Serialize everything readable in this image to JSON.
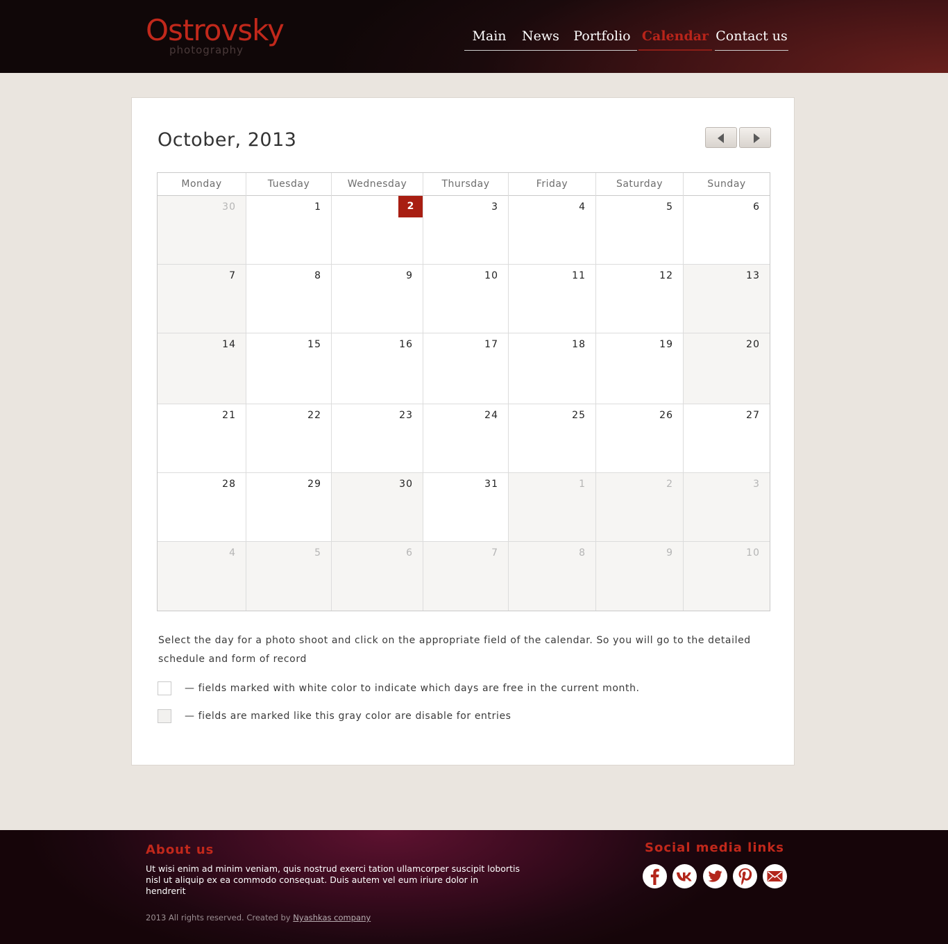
{
  "header": {
    "logo_main": "Ostrovsky",
    "logo_sub": "photography",
    "nav": [
      {
        "label": "Main",
        "active": false
      },
      {
        "label": "News",
        "active": false
      },
      {
        "label": "Portfolio",
        "active": false
      },
      {
        "label": "Calendar",
        "active": true
      },
      {
        "label": "Contact us",
        "active": false
      }
    ]
  },
  "calendar": {
    "title": "October, 2013",
    "prev_icon": "chevron-left-icon",
    "next_icon": "chevron-right-icon",
    "weekdays": [
      "Monday",
      "Tuesday",
      "Wednesday",
      "Thursday",
      "Friday",
      "Saturday",
      "Sunday"
    ],
    "today": "2",
    "weeks": [
      [
        {
          "day": "30",
          "other": true,
          "gray": true
        },
        {
          "day": "1"
        },
        {
          "day": "2",
          "today": true
        },
        {
          "day": "3"
        },
        {
          "day": "4"
        },
        {
          "day": "5"
        },
        {
          "day": "6"
        }
      ],
      [
        {
          "day": "7",
          "gray": true
        },
        {
          "day": "8"
        },
        {
          "day": "9"
        },
        {
          "day": "10"
        },
        {
          "day": "11"
        },
        {
          "day": "12"
        },
        {
          "day": "13",
          "gray": true
        }
      ],
      [
        {
          "day": "14",
          "gray": true
        },
        {
          "day": "15"
        },
        {
          "day": "16"
        },
        {
          "day": "17"
        },
        {
          "day": "18"
        },
        {
          "day": "19"
        },
        {
          "day": "20",
          "gray": true
        }
      ],
      [
        {
          "day": "21"
        },
        {
          "day": "22"
        },
        {
          "day": "23"
        },
        {
          "day": "24"
        },
        {
          "day": "25"
        },
        {
          "day": "26"
        },
        {
          "day": "27"
        }
      ],
      [
        {
          "day": "28"
        },
        {
          "day": "29"
        },
        {
          "day": "30",
          "gray": true
        },
        {
          "day": "31"
        },
        {
          "day": "1",
          "other": true,
          "gray": true
        },
        {
          "day": "2",
          "other": true,
          "gray": true
        },
        {
          "day": "3",
          "other": true,
          "gray": true
        }
      ],
      [
        {
          "day": "4",
          "other": true,
          "gray": true
        },
        {
          "day": "5",
          "other": true,
          "gray": true
        },
        {
          "day": "6",
          "other": true,
          "gray": true
        },
        {
          "day": "7",
          "other": true,
          "gray": true
        },
        {
          "day": "8",
          "other": true,
          "gray": true
        },
        {
          "day": "9",
          "other": true,
          "gray": true
        },
        {
          "day": "10",
          "other": true,
          "gray": true
        }
      ]
    ],
    "instructions": "Select the day for a photo shoot and click on the appropriate field of the calendar. So you will go to the detailed schedule and form  of record",
    "legend": [
      {
        "text": "— fields marked with white color to indicate which days are free in the current month."
      },
      {
        "text": "— fields are marked like this gray color are disable for entries"
      }
    ]
  },
  "footer": {
    "about_title": "About us",
    "about_text": "Ut wisi enim ad minim veniam, quis nostrud exerci tation ullamcorper suscipit lobortis nisl ut aliquip ex ea commodo consequat. Duis autem vel eum iriure dolor in hendrerit",
    "copyright_prefix": "2013 All rights reserved. Created by ",
    "copyright_link": "Nyashkas company",
    "social_title": "Social media links",
    "social": [
      {
        "name": "facebook-icon"
      },
      {
        "name": "vk-icon"
      },
      {
        "name": "twitter-icon"
      },
      {
        "name": "pinterest-icon"
      },
      {
        "name": "email-icon"
      }
    ]
  },
  "colors": {
    "accent": "#c1281b",
    "today_bg": "#a81e12",
    "page_bg": "#eae5df",
    "gray_cell": "#f6f5f3"
  }
}
